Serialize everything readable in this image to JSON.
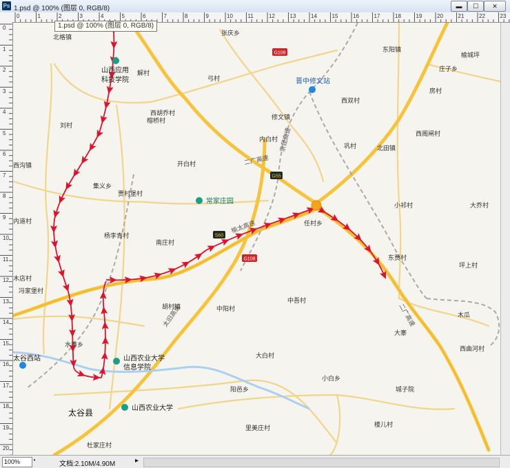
{
  "window": {
    "app_icon": "Ps",
    "title": "1.psd @ 100% (图层 0, RGB/8)",
    "tooltip": "1.psd @ 100% (图层 0, RGB/8)",
    "buttons": {
      "minimize": "▬",
      "maximize": "☐",
      "close": "✕"
    }
  },
  "ruler": {
    "top_ticks": [
      "0",
      "1",
      "2",
      "3",
      "4",
      "5",
      "6",
      "7",
      "8",
      "9",
      "10",
      "11",
      "12",
      "13",
      "14",
      "15",
      "16",
      "17",
      "18",
      "19",
      "20",
      "21",
      "22",
      "23"
    ],
    "left_ticks": [
      "0",
      "1",
      "2",
      "3",
      "4",
      "5",
      "6",
      "7",
      "8",
      "9",
      "10",
      "11",
      "12",
      "13",
      "14",
      "15",
      "16",
      "17",
      "18",
      "19",
      "20"
    ]
  },
  "status": {
    "zoom": "100%",
    "doc_label": "文档:",
    "doc_size": "2.10M/4.90M"
  },
  "map": {
    "places": {
      "zhangqing": "张庆乡",
      "beige": "北格镇",
      "dongyang": "东阳镇",
      "yuchengping": "榆城坪",
      "shanxi_app": "山西应用",
      "shanxi_app2": "科技学院",
      "jie": "解村",
      "gongcun": "弓村",
      "jinzhong_station": "晋中修文站",
      "zhuangzi": "庄子乡",
      "xi_hu": "西胡乔村",
      "yaoqiao": "榕桥村",
      "xiuwen": "修文镇",
      "xishuang": "西双村",
      "fangcun": "房村",
      "liucun": "刘村",
      "neibai": "内白村",
      "gongcun2": "巩村",
      "beitian": "北田镇",
      "xigou": "西沟镇",
      "kaibai": "开白村",
      "xiguan": "西阁闸村",
      "jiyi": "集义乡",
      "guanbao": "贾村堡村",
      "changjia": "常家庄园",
      "xiaoqi": "小祁村",
      "daqiao": "大乔村",
      "neidao": "内道村",
      "renchun": "任村乡",
      "yangli": "杨李青村",
      "nanzhuang": "南庄村",
      "dongyun": "东贾村",
      "pingshang": "坪上村",
      "mudian": "木店村",
      "fengjia": "冯家堡村",
      "huchuan": "胡村镇",
      "zhongyang": "中阳村",
      "zhongmu": "中吾村",
      "mugua": "木瓜",
      "dasai": "大寨",
      "shuixiu": "水秀乡",
      "xiqu": "西曲河村",
      "taigu_west": "太谷西站",
      "shanxi_agri_info": "山西农业大学",
      "shanxi_agri_info2": "信息学院",
      "dabai": "大白村",
      "xiaobai": "小白乡",
      "yangyi": "阳邑乡",
      "chengzi": "城子院",
      "taigu": "太谷县",
      "shanxi_agri": "山西农业大学",
      "limei": "里美庄村",
      "louer": "楼儿村",
      "duzhuang": "杜家庄村"
    },
    "road_badges": {
      "g108a": "G108",
      "g108b": "G108",
      "g55": "G55",
      "s60": "S60"
    },
    "road_names": {
      "jingkun": "京昆高速",
      "erguang": "二广高速",
      "yuhuan": "榆太高速",
      "erguang2": "二广高速",
      "taijiu": "太旧高速"
    },
    "colors": {
      "highway": "#f5c233",
      "route": "#e0112b",
      "water": "#a9cff3",
      "rail": "#a9a9a9",
      "poi_green": "#16a085",
      "poi_blue": "#1e88e5",
      "badge_red": "#d2232a",
      "badge_dark": "#1d2a1f"
    }
  }
}
